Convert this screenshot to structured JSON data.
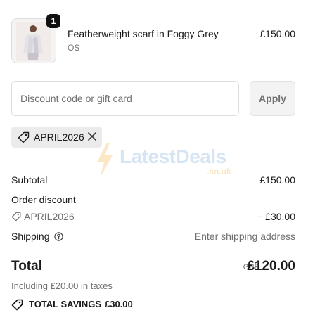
{
  "product": {
    "name": "Featherweight scarf in Foggy Grey",
    "variant": "OS",
    "price": "£150.00",
    "quantity": "1"
  },
  "discount": {
    "placeholder": "Discount code or gift card",
    "apply_label": "Apply",
    "applied_code": "APRIL2026"
  },
  "watermark": {
    "text": "LatestDeals",
    "sub": ".co.uk"
  },
  "summary": {
    "subtotal_label": "Subtotal",
    "subtotal_value": "£150.00",
    "order_discount_label": "Order discount",
    "order_discount_code": "APRIL2026",
    "order_discount_value": "− £30.00",
    "shipping_label": "Shipping",
    "shipping_value": "Enter shipping address",
    "total_label": "Total",
    "total_currency": "GBP",
    "total_value": "£120.00",
    "tax_note": "Including £20.00 in taxes",
    "savings_label": "TOTAL SAVINGS",
    "savings_value": "£30.00"
  },
  "icons": {
    "tag": "tag-icon",
    "close": "close-icon",
    "help": "help-circle-icon",
    "lightning": "lightning-icon"
  }
}
